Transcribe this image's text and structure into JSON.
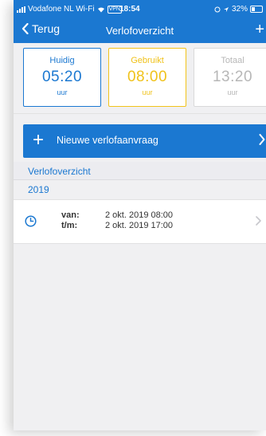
{
  "status": {
    "carrier": "Vodafone NL Wi-Fi",
    "vpn": "VPN",
    "time": "18:54",
    "battery": "32%"
  },
  "nav": {
    "back_label": "Terug",
    "title": "Verlofoverzicht",
    "add_label": "+"
  },
  "summary": {
    "current": {
      "label": "Huidig",
      "value": "05:20",
      "unit": "uur"
    },
    "used": {
      "label": "Gebruikt",
      "value": "08:00",
      "unit": "uur"
    },
    "total": {
      "label": "Totaal",
      "value": "13:20",
      "unit": "uur"
    }
  },
  "new_request": {
    "icon": "+",
    "label": "Nieuwe verlofaanvraag"
  },
  "overview": {
    "section_title": "Verlofoverzicht",
    "year": "2019",
    "entries": [
      {
        "from_label": "van:",
        "from_value": "2 okt. 2019 08:00",
        "to_label": "t/m:",
        "to_value": "2 okt. 2019 17:00"
      }
    ]
  },
  "colors": {
    "primary": "#1b78d1",
    "used": "#f0c21a",
    "total": "#b7b7b7"
  }
}
